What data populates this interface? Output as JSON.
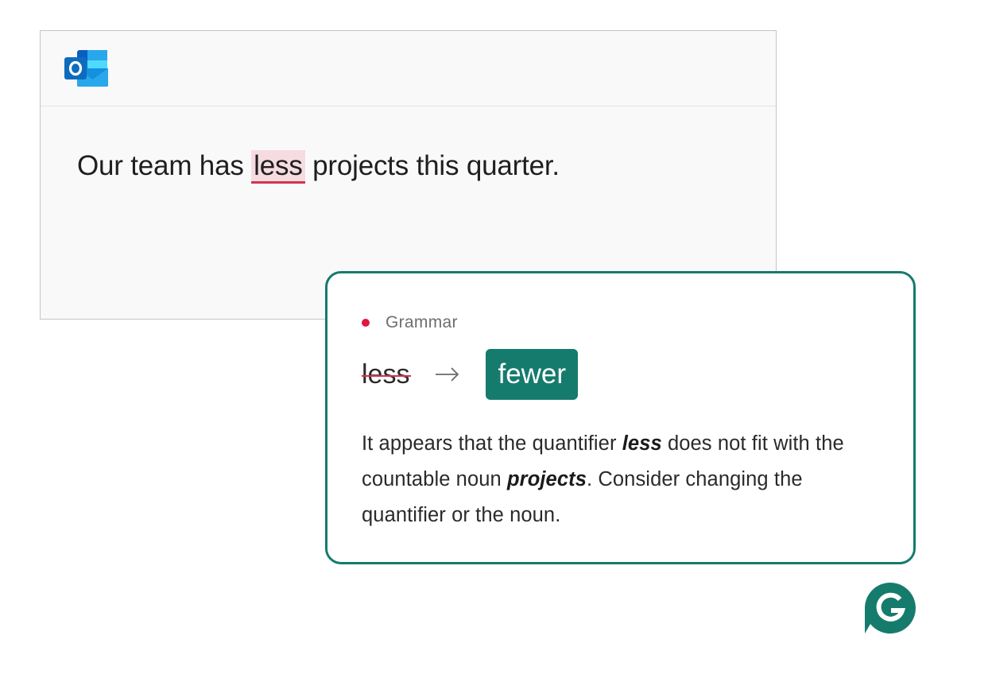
{
  "compose": {
    "text_before": "Our team has ",
    "flagged_word": "less",
    "text_after": " projects this quarter."
  },
  "suggestion": {
    "category": "Grammar",
    "original": "less",
    "replacement": "fewer",
    "explanation": {
      "part1": "It appears that the quantifier ",
      "emph1": "less",
      "part2": " does not fit with the countable noun ",
      "emph2": "projects",
      "part3": ". Consider changing the quantifier or the noun."
    }
  },
  "icons": {
    "app_logo": "outlook-logo-icon",
    "arrow": "arrow-right-icon",
    "assistant_logo": "grammarly-logo-icon"
  },
  "colors": {
    "accent": "#157b6d",
    "error": "#d1344d",
    "error_highlight": "#f6dbe1",
    "category_dot": "#e0173f"
  }
}
